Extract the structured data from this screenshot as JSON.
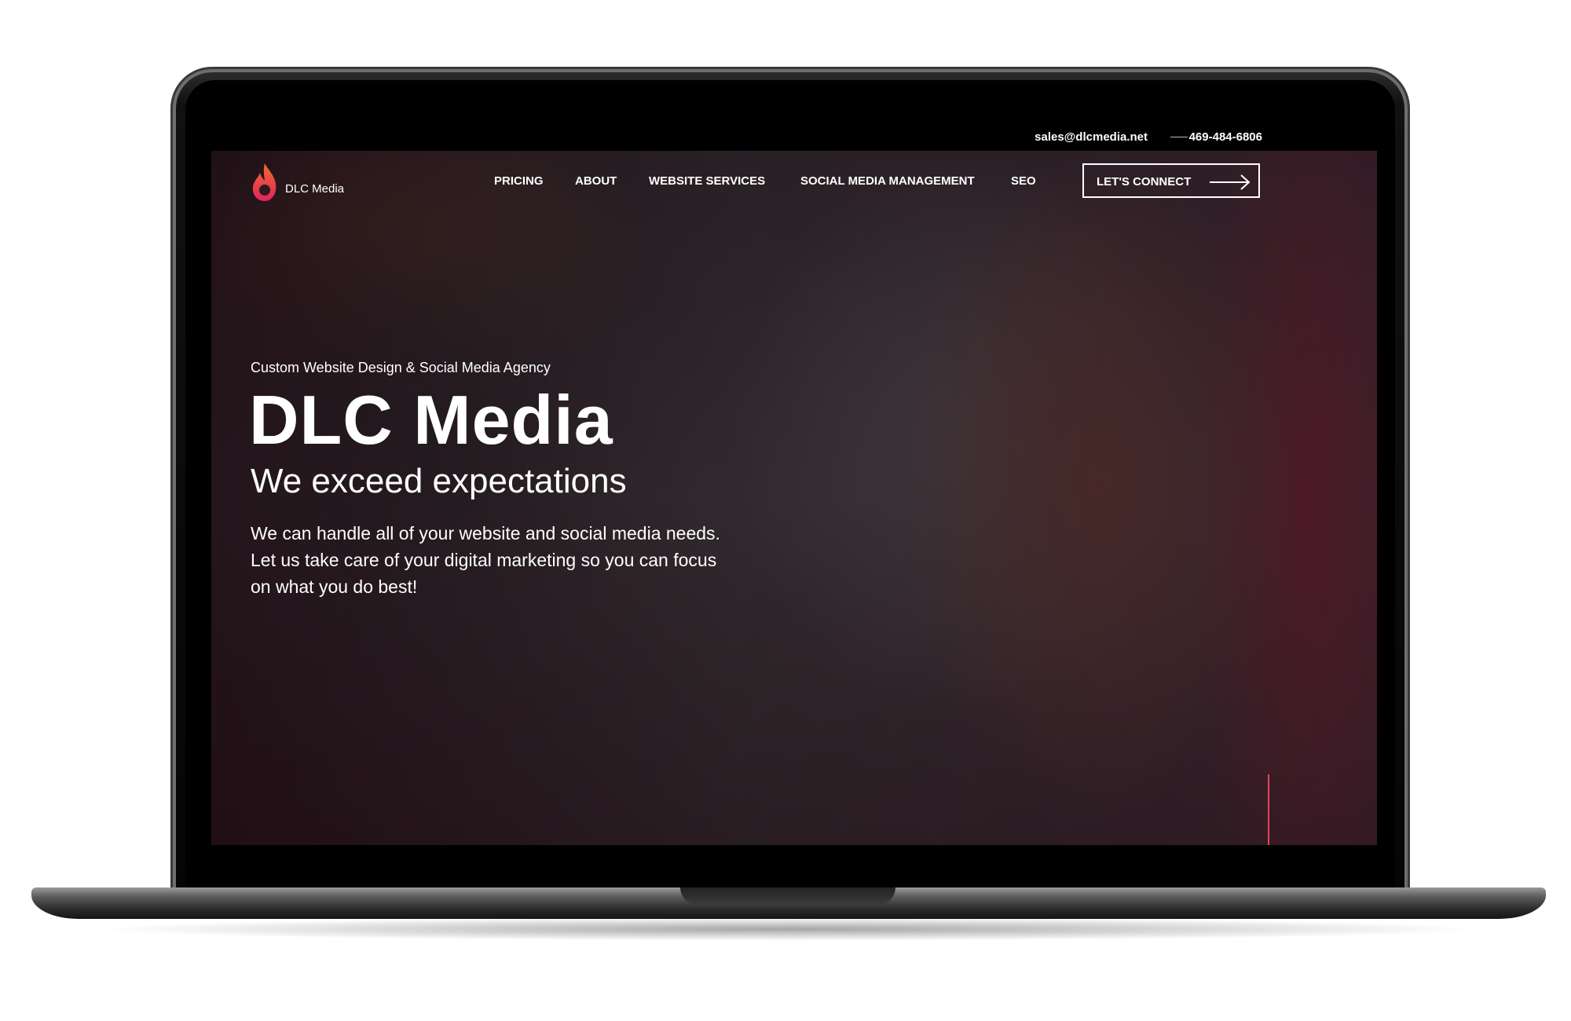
{
  "topbar": {
    "email": "sales@dlcmedia.net",
    "phone": "469-484-6806"
  },
  "logo": {
    "name": "DLC Media"
  },
  "nav": {
    "items": [
      "PRICING",
      "ABOUT",
      "WEBSITE SERVICES",
      "SOCIAL MEDIA MANAGEMENT",
      "SEO"
    ]
  },
  "cta": {
    "label": "LET'S CONNECT"
  },
  "hero": {
    "eyebrow": "Custom Website Design & Social Media Agency",
    "headline": "DLC Media",
    "tagline": "We exceed expectations",
    "body_lines": [
      "We can handle all of your website and social media needs.",
      "Let us take care of your digital marketing so you can focus",
      "on what you do best!"
    ]
  },
  "colors": {
    "brand_pink": "#e0245e",
    "brand_orange": "#f26b2a",
    "accent_line": "#e0455a"
  }
}
